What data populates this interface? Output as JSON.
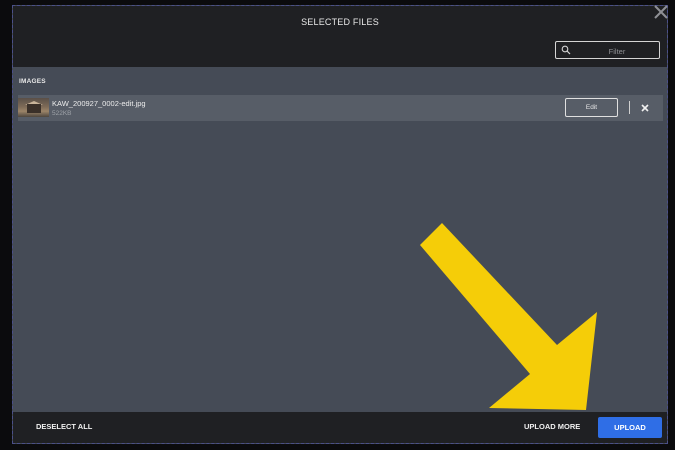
{
  "modal": {
    "title": "SELECTED FILES"
  },
  "filter": {
    "placeholder": "Filter",
    "value": ""
  },
  "section": {
    "label": "IMAGES"
  },
  "files": [
    {
      "name": "KAW_200927_0002-edit.jpg",
      "size": "522KB",
      "edit_label": "Edit"
    }
  ],
  "footer": {
    "deselect_all_label": "DESELECT ALL",
    "upload_more_label": "UPLOAD MORE",
    "upload_label": "UPLOAD"
  },
  "icons": {
    "close": "close-icon",
    "search": "search-icon",
    "remove": "close-icon",
    "annotation": "arrow-icon"
  },
  "colors": {
    "accent": "#2f6ee6",
    "annotation_arrow": "#f5cd08",
    "header_bg": "#1f2023",
    "body_bg": "#454b56"
  }
}
